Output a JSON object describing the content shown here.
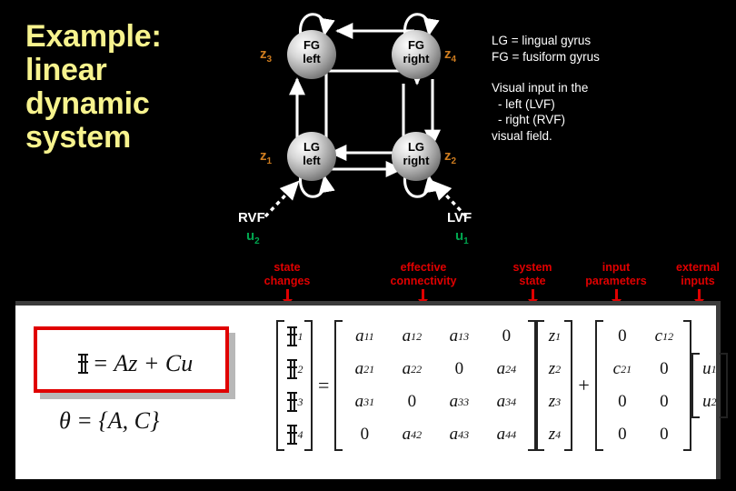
{
  "title": "Example: linear dynamic system",
  "colors": {
    "title": "#F7F38E",
    "state_label": "#CE7C1F",
    "input_label": "#00A64F",
    "annotation": "#E00000",
    "legend_text": "#FFFFFF",
    "background": "#000000",
    "panel": "#FFFFFF"
  },
  "diagram": {
    "nodes": [
      {
        "id": "fg-left",
        "line1": "FG",
        "line2": "left",
        "state": "z",
        "state_sub": "3"
      },
      {
        "id": "fg-right",
        "line1": "FG",
        "line2": "right",
        "state": "z",
        "state_sub": "4"
      },
      {
        "id": "lg-left",
        "line1": "LG",
        "line2": "left",
        "state": "z",
        "state_sub": "1"
      },
      {
        "id": "lg-right",
        "line1": "LG",
        "line2": "right",
        "state": "z",
        "state_sub": "2"
      }
    ],
    "inputs": [
      {
        "id": "rvf",
        "field_label": "RVF",
        "input": "u",
        "input_sub": "2"
      },
      {
        "id": "lvf",
        "field_label": "LVF",
        "input": "u",
        "input_sub": "1"
      }
    ]
  },
  "legend": {
    "abbrev": [
      "LG = lingual gyrus",
      "FG = fusiform gyrus"
    ],
    "description": [
      "Visual input in the",
      "- left (LVF)",
      "- right (RVF)",
      "visual field."
    ]
  },
  "annotations": [
    {
      "id": "state-changes",
      "line1": "state",
      "line2": "changes"
    },
    {
      "id": "effective-connectivity",
      "line1": "effective",
      "line2": "connectivity"
    },
    {
      "id": "system-state",
      "line1": "system",
      "line2": "state"
    },
    {
      "id": "input-parameters",
      "line1": "input",
      "line2": "parameters"
    },
    {
      "id": "external-inputs",
      "line1": "external",
      "line2": "inputs"
    }
  ],
  "equations": {
    "boxed": {
      "lhs_glyph": "zdot",
      "rhs": "= Az + Cu"
    },
    "theta": "θ = {A, C}"
  },
  "matrix_equation": {
    "lhs_vector": [
      {
        "glyph": "zdot",
        "sub": "1"
      },
      {
        "glyph": "zdot",
        "sub": "2"
      },
      {
        "glyph": "zdot",
        "sub": "3"
      },
      {
        "glyph": "zdot",
        "sub": "4"
      }
    ],
    "equals": "=",
    "A": [
      [
        {
          "sym": "a",
          "sub": "11"
        },
        {
          "sym": "a",
          "sub": "12"
        },
        {
          "sym": "a",
          "sub": "13"
        },
        {
          "sym": "0",
          "sub": ""
        }
      ],
      [
        {
          "sym": "a",
          "sub": "21"
        },
        {
          "sym": "a",
          "sub": "22"
        },
        {
          "sym": "0",
          "sub": ""
        },
        {
          "sym": "a",
          "sub": "24"
        }
      ],
      [
        {
          "sym": "a",
          "sub": "31"
        },
        {
          "sym": "0",
          "sub": ""
        },
        {
          "sym": "a",
          "sub": "33"
        },
        {
          "sym": "a",
          "sub": "34"
        }
      ],
      [
        {
          "sym": "0",
          "sub": ""
        },
        {
          "sym": "a",
          "sub": "42"
        },
        {
          "sym": "a",
          "sub": "43"
        },
        {
          "sym": "a",
          "sub": "44"
        }
      ]
    ],
    "z_vector": [
      {
        "sym": "z",
        "sub": "1"
      },
      {
        "sym": "z",
        "sub": "2"
      },
      {
        "sym": "z",
        "sub": "3"
      },
      {
        "sym": "z",
        "sub": "4"
      }
    ],
    "plus": "+",
    "C": [
      [
        {
          "sym": "0",
          "sub": ""
        },
        {
          "sym": "c",
          "sub": "12"
        }
      ],
      [
        {
          "sym": "c",
          "sub": "21"
        },
        {
          "sym": "0",
          "sub": ""
        }
      ],
      [
        {
          "sym": "0",
          "sub": ""
        },
        {
          "sym": "0",
          "sub": ""
        }
      ],
      [
        {
          "sym": "0",
          "sub": ""
        },
        {
          "sym": "0",
          "sub": ""
        }
      ]
    ],
    "u_vector": [
      {
        "sym": "u",
        "sub": "1"
      },
      {
        "sym": "u",
        "sub": "2"
      }
    ]
  }
}
